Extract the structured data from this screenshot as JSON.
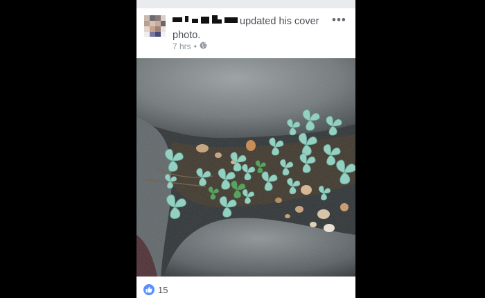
{
  "post": {
    "author_name": "",
    "action_text": "updated his cover photo.",
    "timestamp": "7 hrs",
    "separator": "•",
    "privacy_icon": "globe-icon",
    "menu_icon": "more-options-icon",
    "menu_label": "•••",
    "photo_subject": "",
    "reactions": {
      "icon": "like-icon",
      "count": "15"
    }
  },
  "colors": {
    "like_blue": "#5890ff",
    "meta_gray": "#90949c",
    "text_gray": "#4b4f56",
    "background": "#000000"
  }
}
